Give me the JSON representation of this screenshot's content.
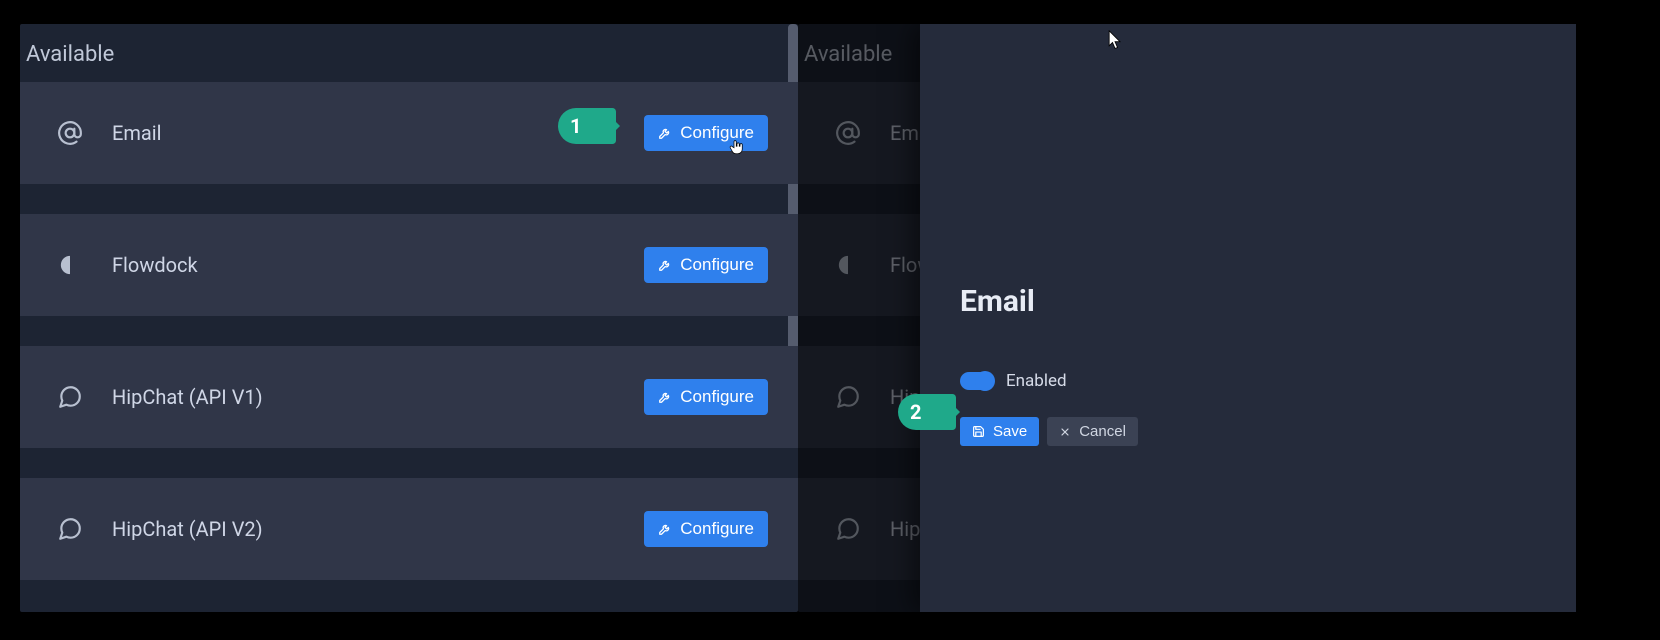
{
  "left": {
    "section_title": "Available",
    "items": [
      {
        "label": "Email",
        "button": "Configure"
      },
      {
        "label": "Flowdock",
        "button": "Configure"
      },
      {
        "label": "HipChat (API V1)",
        "button": "Configure"
      },
      {
        "label": "HipChat (API V2)",
        "button": "Configure"
      }
    ]
  },
  "right": {
    "section_title": "Available",
    "items": [
      {
        "label": "Email"
      },
      {
        "label": "Flowdock"
      },
      {
        "label": "HipChat"
      },
      {
        "label": "HipChat"
      }
    ]
  },
  "slideout": {
    "heading": "Email",
    "toggle_label": "Enabled",
    "save_label": "Save",
    "cancel_label": "Cancel"
  },
  "callouts": {
    "one": "1",
    "two": "2"
  }
}
